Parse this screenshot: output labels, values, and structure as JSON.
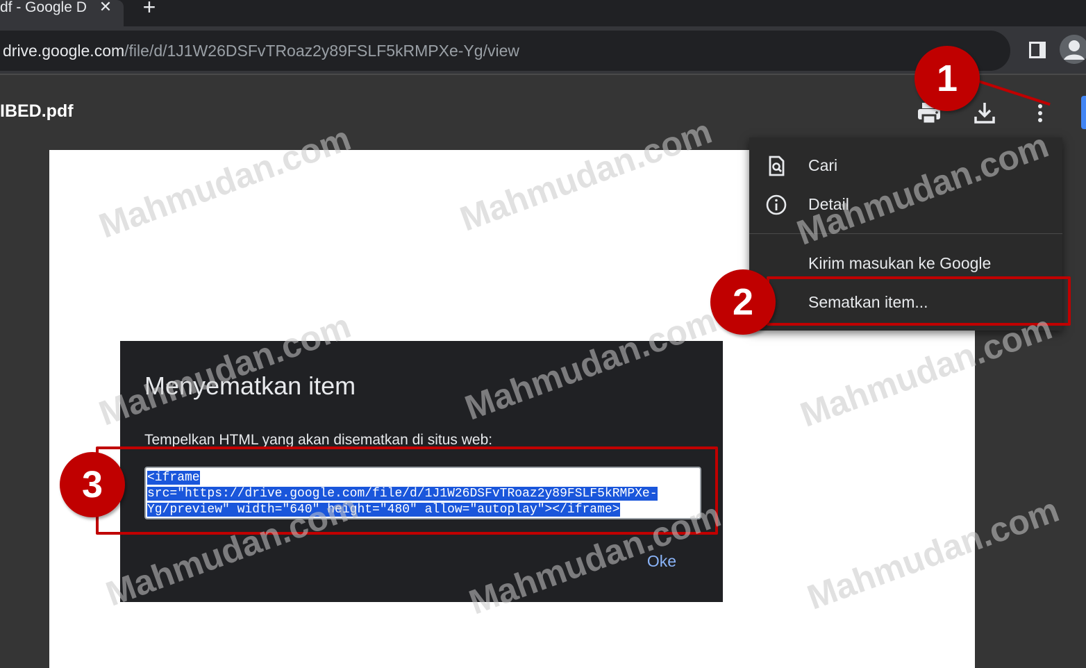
{
  "browser": {
    "tab_title": "df - Google D",
    "tab_close": "✕",
    "new_tab": "+",
    "url_host": "drive.google.com",
    "url_path": "/file/d/1J1W26DSFvTRoaz2y89FSLF5kRMPXe-Yg/view"
  },
  "viewer": {
    "file_name": "IBED.pdf",
    "icons": [
      "print-icon",
      "download-icon",
      "more-vert-icon"
    ]
  },
  "menu": {
    "items": [
      {
        "label": "Cari",
        "icon": "find-in-page-icon"
      },
      {
        "label": "Detail",
        "icon": "info-icon"
      },
      {
        "label": "Kirim masukan ke Google",
        "icon": ""
      },
      {
        "label": "Sematkan item...",
        "icon": ""
      }
    ]
  },
  "dialog": {
    "title": "Menyematkan item",
    "label": "Tempelkan HTML yang akan disematkan di situs web:",
    "embed_code": "<iframe src=\"https://drive.google.com/file/d/1J1W26DSFvTRoaz2y89FSLF5kRMPXe-Yg/preview\" width=\"640\" height=\"480\" allow=\"autoplay\"></iframe>",
    "ok_label": "Oke"
  },
  "annotations": {
    "steps": [
      "1",
      "2",
      "3"
    ],
    "color": "#c00000"
  },
  "watermark": "Mahmudan.com",
  "colors": {
    "accent": "#8ab4f8",
    "selection": "#1a56db",
    "annotation": "#c00000"
  }
}
